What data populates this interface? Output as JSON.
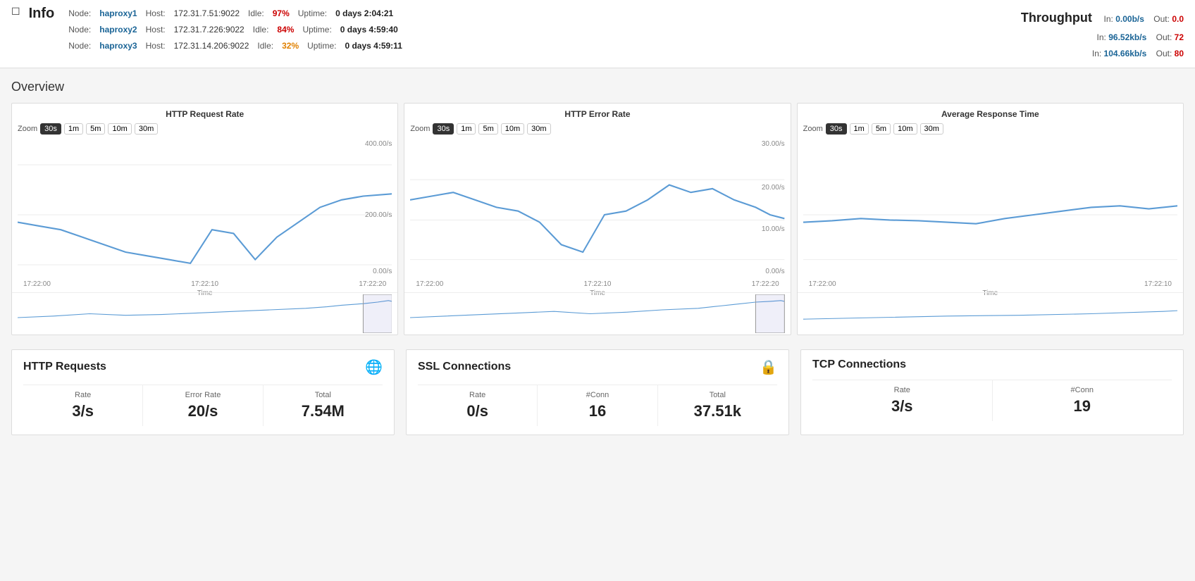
{
  "header": {
    "toggle": "☐",
    "info_title": "Info",
    "throughput_title": "Throughput",
    "nodes": [
      {
        "label": "Node:",
        "name": "haproxy1",
        "host_label": "Host:",
        "host": "172.31.7.51:9022",
        "idle_label": "Idle:",
        "idle": "97%",
        "uptime_label": "Uptime:",
        "uptime": "0 days 2:04:21",
        "idle_class": "high"
      },
      {
        "label": "Node:",
        "name": "haproxy2",
        "host_label": "Host:",
        "host": "172.31.7.226:9022",
        "idle_label": "Idle:",
        "idle": "84%",
        "uptime_label": "Uptime:",
        "uptime": "0 days 4:59:40",
        "idle_class": "high"
      },
      {
        "label": "Node:",
        "name": "haproxy3",
        "host_label": "Host:",
        "host": "172.31.14.206:9022",
        "idle_label": "Idle:",
        "idle": "32%",
        "uptime_label": "Uptime:",
        "uptime": "0 days 4:59:11",
        "idle_class": "mid"
      }
    ],
    "throughput_rows": [
      {
        "in_label": "In:",
        "in_val": "0.00b/s",
        "out_label": "Out:",
        "out_val": "0.0"
      },
      {
        "in_label": "In:",
        "in_val": "96.52kb/s",
        "out_label": "Out:",
        "out_val": "72"
      },
      {
        "in_label": "In:",
        "in_val": "104.66kb/s",
        "out_label": "Out:",
        "out_val": "80"
      }
    ]
  },
  "overview": {
    "title": "Overview"
  },
  "charts": [
    {
      "id": "http-request-rate",
      "title": "HTTP Request Rate",
      "zoom_label": "Zoom",
      "zoom_options": [
        "30s",
        "1m",
        "5m",
        "10m",
        "30m"
      ],
      "zoom_active": "30s",
      "y_labels": [
        "400.00/s",
        "200.00/s",
        "0.00/s"
      ],
      "x_labels": [
        "17:22:00",
        "17:22:10",
        "17:22:20"
      ],
      "x_axis_label": "Time"
    },
    {
      "id": "http-error-rate",
      "title": "HTTP Error Rate",
      "zoom_label": "Zoom",
      "zoom_options": [
        "30s",
        "1m",
        "5m",
        "10m",
        "30m"
      ],
      "zoom_active": "30s",
      "y_labels": [
        "30.00/s",
        "20.00/s",
        "10.00/s",
        "0.00/s"
      ],
      "x_labels": [
        "17:22:00",
        "17:22:10",
        "17:22:20"
      ],
      "x_axis_label": "Time"
    },
    {
      "id": "avg-response-time",
      "title": "Average Response Time",
      "zoom_label": "Zoom",
      "zoom_options": [
        "30s",
        "1m",
        "5m",
        "10m",
        "30m"
      ],
      "zoom_active": "30s",
      "y_labels": [],
      "x_labels": [
        "17:22:00",
        "17:22:10"
      ],
      "x_axis_label": "Time"
    }
  ],
  "stats": [
    {
      "id": "http-requests",
      "title": "HTTP Requests",
      "icon": "🌐",
      "icon_color": "#4caf50",
      "metrics": [
        {
          "label": "Rate",
          "value": "3/s"
        },
        {
          "label": "Error Rate",
          "value": "20/s"
        },
        {
          "label": "Total",
          "value": "7.54M"
        }
      ]
    },
    {
      "id": "ssl-connections",
      "title": "SSL Connections",
      "icon": "🔒",
      "icon_color": "#4caf50",
      "metrics": [
        {
          "label": "Rate",
          "value": "0/s"
        },
        {
          "label": "#Conn",
          "value": "16"
        },
        {
          "label": "Total",
          "value": "37.51k"
        }
      ]
    },
    {
      "id": "tcp-connections",
      "title": "TCP Connections",
      "icon": "",
      "icon_color": "",
      "metrics": [
        {
          "label": "Rate",
          "value": "3/s"
        },
        {
          "label": "#Conn",
          "value": "19"
        }
      ]
    }
  ]
}
